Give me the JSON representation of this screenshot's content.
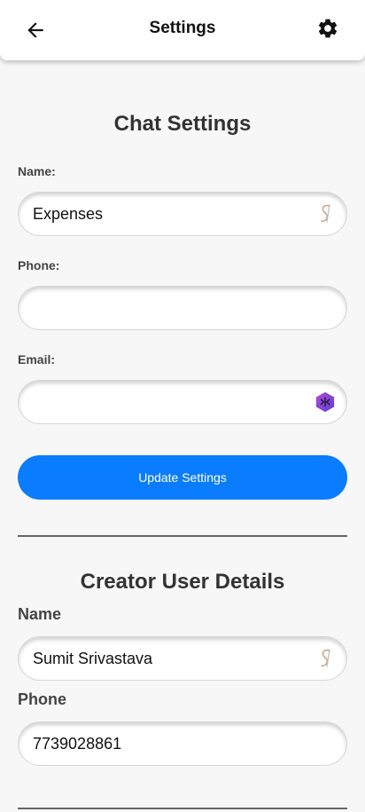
{
  "header": {
    "title": "Settings",
    "back_icon": "arrow-left-icon",
    "settings_icon": "gear-icon"
  },
  "chat_settings": {
    "heading": "Chat Settings",
    "name_label": "Name:",
    "name_value": "Expenses",
    "phone_label": "Phone:",
    "phone_value": "",
    "email_label": "Email:",
    "email_value": "",
    "update_button": "Update Settings"
  },
  "creator": {
    "heading": "Creator User Details",
    "name_label": "Name",
    "name_value": "Sumit Srivastava",
    "phone_label": "Phone",
    "phone_value": "7739028861"
  },
  "colors": {
    "accent": "#0a7cff",
    "background": "#f7f7f7"
  }
}
